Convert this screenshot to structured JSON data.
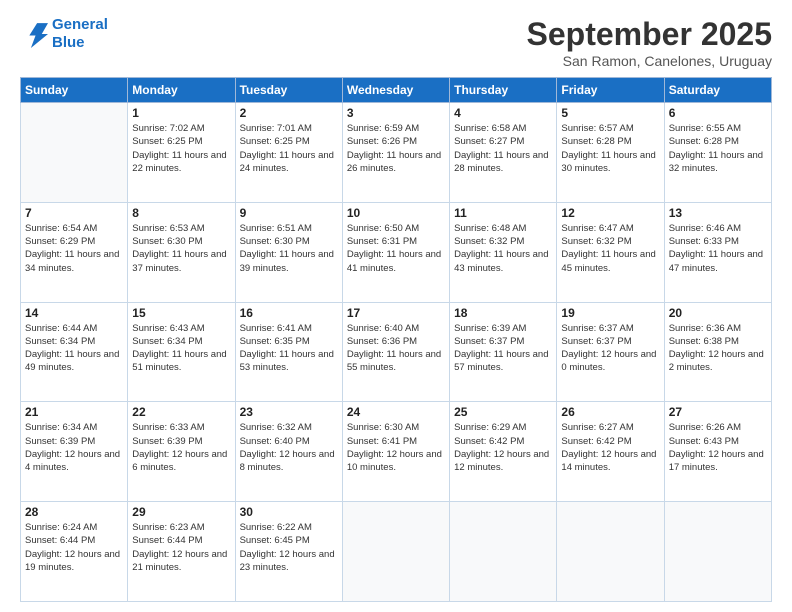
{
  "logo": {
    "line1": "General",
    "line2": "Blue"
  },
  "title": "September 2025",
  "subtitle": "San Ramon, Canelones, Uruguay",
  "days_of_week": [
    "Sunday",
    "Monday",
    "Tuesday",
    "Wednesday",
    "Thursday",
    "Friday",
    "Saturday"
  ],
  "weeks": [
    [
      {
        "day": "",
        "sunrise": "",
        "sunset": "",
        "daylight": ""
      },
      {
        "day": "1",
        "sunrise": "Sunrise: 7:02 AM",
        "sunset": "Sunset: 6:25 PM",
        "daylight": "Daylight: 11 hours and 22 minutes."
      },
      {
        "day": "2",
        "sunrise": "Sunrise: 7:01 AM",
        "sunset": "Sunset: 6:25 PM",
        "daylight": "Daylight: 11 hours and 24 minutes."
      },
      {
        "day": "3",
        "sunrise": "Sunrise: 6:59 AM",
        "sunset": "Sunset: 6:26 PM",
        "daylight": "Daylight: 11 hours and 26 minutes."
      },
      {
        "day": "4",
        "sunrise": "Sunrise: 6:58 AM",
        "sunset": "Sunset: 6:27 PM",
        "daylight": "Daylight: 11 hours and 28 minutes."
      },
      {
        "day": "5",
        "sunrise": "Sunrise: 6:57 AM",
        "sunset": "Sunset: 6:28 PM",
        "daylight": "Daylight: 11 hours and 30 minutes."
      },
      {
        "day": "6",
        "sunrise": "Sunrise: 6:55 AM",
        "sunset": "Sunset: 6:28 PM",
        "daylight": "Daylight: 11 hours and 32 minutes."
      }
    ],
    [
      {
        "day": "7",
        "sunrise": "Sunrise: 6:54 AM",
        "sunset": "Sunset: 6:29 PM",
        "daylight": "Daylight: 11 hours and 34 minutes."
      },
      {
        "day": "8",
        "sunrise": "Sunrise: 6:53 AM",
        "sunset": "Sunset: 6:30 PM",
        "daylight": "Daylight: 11 hours and 37 minutes."
      },
      {
        "day": "9",
        "sunrise": "Sunrise: 6:51 AM",
        "sunset": "Sunset: 6:30 PM",
        "daylight": "Daylight: 11 hours and 39 minutes."
      },
      {
        "day": "10",
        "sunrise": "Sunrise: 6:50 AM",
        "sunset": "Sunset: 6:31 PM",
        "daylight": "Daylight: 11 hours and 41 minutes."
      },
      {
        "day": "11",
        "sunrise": "Sunrise: 6:48 AM",
        "sunset": "Sunset: 6:32 PM",
        "daylight": "Daylight: 11 hours and 43 minutes."
      },
      {
        "day": "12",
        "sunrise": "Sunrise: 6:47 AM",
        "sunset": "Sunset: 6:32 PM",
        "daylight": "Daylight: 11 hours and 45 minutes."
      },
      {
        "day": "13",
        "sunrise": "Sunrise: 6:46 AM",
        "sunset": "Sunset: 6:33 PM",
        "daylight": "Daylight: 11 hours and 47 minutes."
      }
    ],
    [
      {
        "day": "14",
        "sunrise": "Sunrise: 6:44 AM",
        "sunset": "Sunset: 6:34 PM",
        "daylight": "Daylight: 11 hours and 49 minutes."
      },
      {
        "day": "15",
        "sunrise": "Sunrise: 6:43 AM",
        "sunset": "Sunset: 6:34 PM",
        "daylight": "Daylight: 11 hours and 51 minutes."
      },
      {
        "day": "16",
        "sunrise": "Sunrise: 6:41 AM",
        "sunset": "Sunset: 6:35 PM",
        "daylight": "Daylight: 11 hours and 53 minutes."
      },
      {
        "day": "17",
        "sunrise": "Sunrise: 6:40 AM",
        "sunset": "Sunset: 6:36 PM",
        "daylight": "Daylight: 11 hours and 55 minutes."
      },
      {
        "day": "18",
        "sunrise": "Sunrise: 6:39 AM",
        "sunset": "Sunset: 6:37 PM",
        "daylight": "Daylight: 11 hours and 57 minutes."
      },
      {
        "day": "19",
        "sunrise": "Sunrise: 6:37 AM",
        "sunset": "Sunset: 6:37 PM",
        "daylight": "Daylight: 12 hours and 0 minutes."
      },
      {
        "day": "20",
        "sunrise": "Sunrise: 6:36 AM",
        "sunset": "Sunset: 6:38 PM",
        "daylight": "Daylight: 12 hours and 2 minutes."
      }
    ],
    [
      {
        "day": "21",
        "sunrise": "Sunrise: 6:34 AM",
        "sunset": "Sunset: 6:39 PM",
        "daylight": "Daylight: 12 hours and 4 minutes."
      },
      {
        "day": "22",
        "sunrise": "Sunrise: 6:33 AM",
        "sunset": "Sunset: 6:39 PM",
        "daylight": "Daylight: 12 hours and 6 minutes."
      },
      {
        "day": "23",
        "sunrise": "Sunrise: 6:32 AM",
        "sunset": "Sunset: 6:40 PM",
        "daylight": "Daylight: 12 hours and 8 minutes."
      },
      {
        "day": "24",
        "sunrise": "Sunrise: 6:30 AM",
        "sunset": "Sunset: 6:41 PM",
        "daylight": "Daylight: 12 hours and 10 minutes."
      },
      {
        "day": "25",
        "sunrise": "Sunrise: 6:29 AM",
        "sunset": "Sunset: 6:42 PM",
        "daylight": "Daylight: 12 hours and 12 minutes."
      },
      {
        "day": "26",
        "sunrise": "Sunrise: 6:27 AM",
        "sunset": "Sunset: 6:42 PM",
        "daylight": "Daylight: 12 hours and 14 minutes."
      },
      {
        "day": "27",
        "sunrise": "Sunrise: 6:26 AM",
        "sunset": "Sunset: 6:43 PM",
        "daylight": "Daylight: 12 hours and 17 minutes."
      }
    ],
    [
      {
        "day": "28",
        "sunrise": "Sunrise: 6:24 AM",
        "sunset": "Sunset: 6:44 PM",
        "daylight": "Daylight: 12 hours and 19 minutes."
      },
      {
        "day": "29",
        "sunrise": "Sunrise: 6:23 AM",
        "sunset": "Sunset: 6:44 PM",
        "daylight": "Daylight: 12 hours and 21 minutes."
      },
      {
        "day": "30",
        "sunrise": "Sunrise: 6:22 AM",
        "sunset": "Sunset: 6:45 PM",
        "daylight": "Daylight: 12 hours and 23 minutes."
      },
      {
        "day": "",
        "sunrise": "",
        "sunset": "",
        "daylight": ""
      },
      {
        "day": "",
        "sunrise": "",
        "sunset": "",
        "daylight": ""
      },
      {
        "day": "",
        "sunrise": "",
        "sunset": "",
        "daylight": ""
      },
      {
        "day": "",
        "sunrise": "",
        "sunset": "",
        "daylight": ""
      }
    ]
  ]
}
